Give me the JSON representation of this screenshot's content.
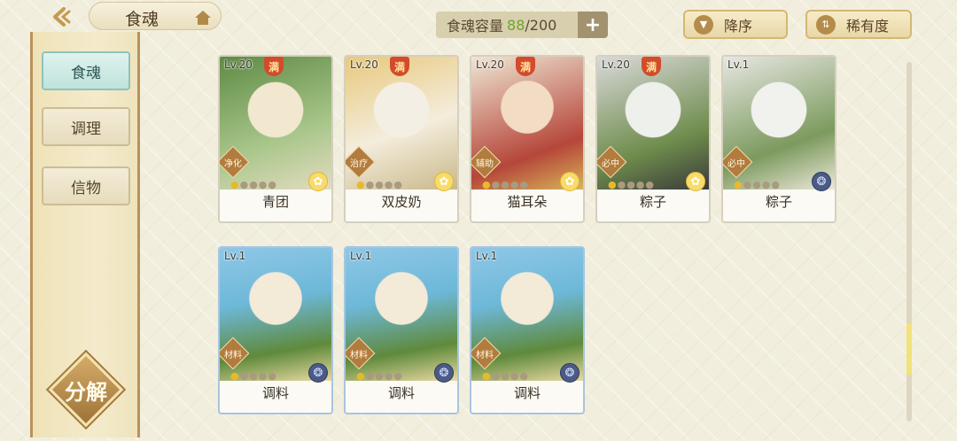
{
  "header": {
    "title": "食魂",
    "capacity": {
      "label": "食魂容量",
      "current": "88",
      "separator": "/",
      "max": "200",
      "add_symbol": "+"
    },
    "sort_order_label": "降序",
    "sort_by_label": "稀有度"
  },
  "sidebar": {
    "items": [
      {
        "label": "食魂",
        "active": true
      },
      {
        "label": "调理",
        "active": false
      },
      {
        "label": "信物",
        "active": false
      }
    ],
    "decompose_label": "分解"
  },
  "cards": [
    {
      "level": "Lv.20",
      "full_badge": "满",
      "role": "净化",
      "name": "青团",
      "element": "sun"
    },
    {
      "level": "Lv.20",
      "full_badge": "满",
      "role": "治疗",
      "name": "双皮奶",
      "element": "sun"
    },
    {
      "level": "Lv.20",
      "full_badge": "满",
      "role": "辅助",
      "name": "猫耳朵",
      "element": "sun"
    },
    {
      "level": "Lv.20",
      "full_badge": "满",
      "role": "必中",
      "name": "粽子",
      "element": "sun"
    },
    {
      "level": "Lv.1",
      "full_badge": "",
      "role": "必中",
      "name": "粽子",
      "element": "dark"
    },
    {
      "level": "Lv.1",
      "full_badge": "",
      "role": "材料",
      "name": "调料",
      "element": "dark"
    },
    {
      "level": "Lv.1",
      "full_badge": "",
      "role": "材料",
      "name": "调料",
      "element": "dark"
    },
    {
      "level": "Lv.1",
      "full_badge": "",
      "role": "材料",
      "name": "调料",
      "element": "dark"
    }
  ],
  "scroll_position": 0.85,
  "colors": {
    "accent_green": "#6aa62a",
    "active_tab": "#bfe3dc",
    "full_badge": "#d24b2a"
  }
}
